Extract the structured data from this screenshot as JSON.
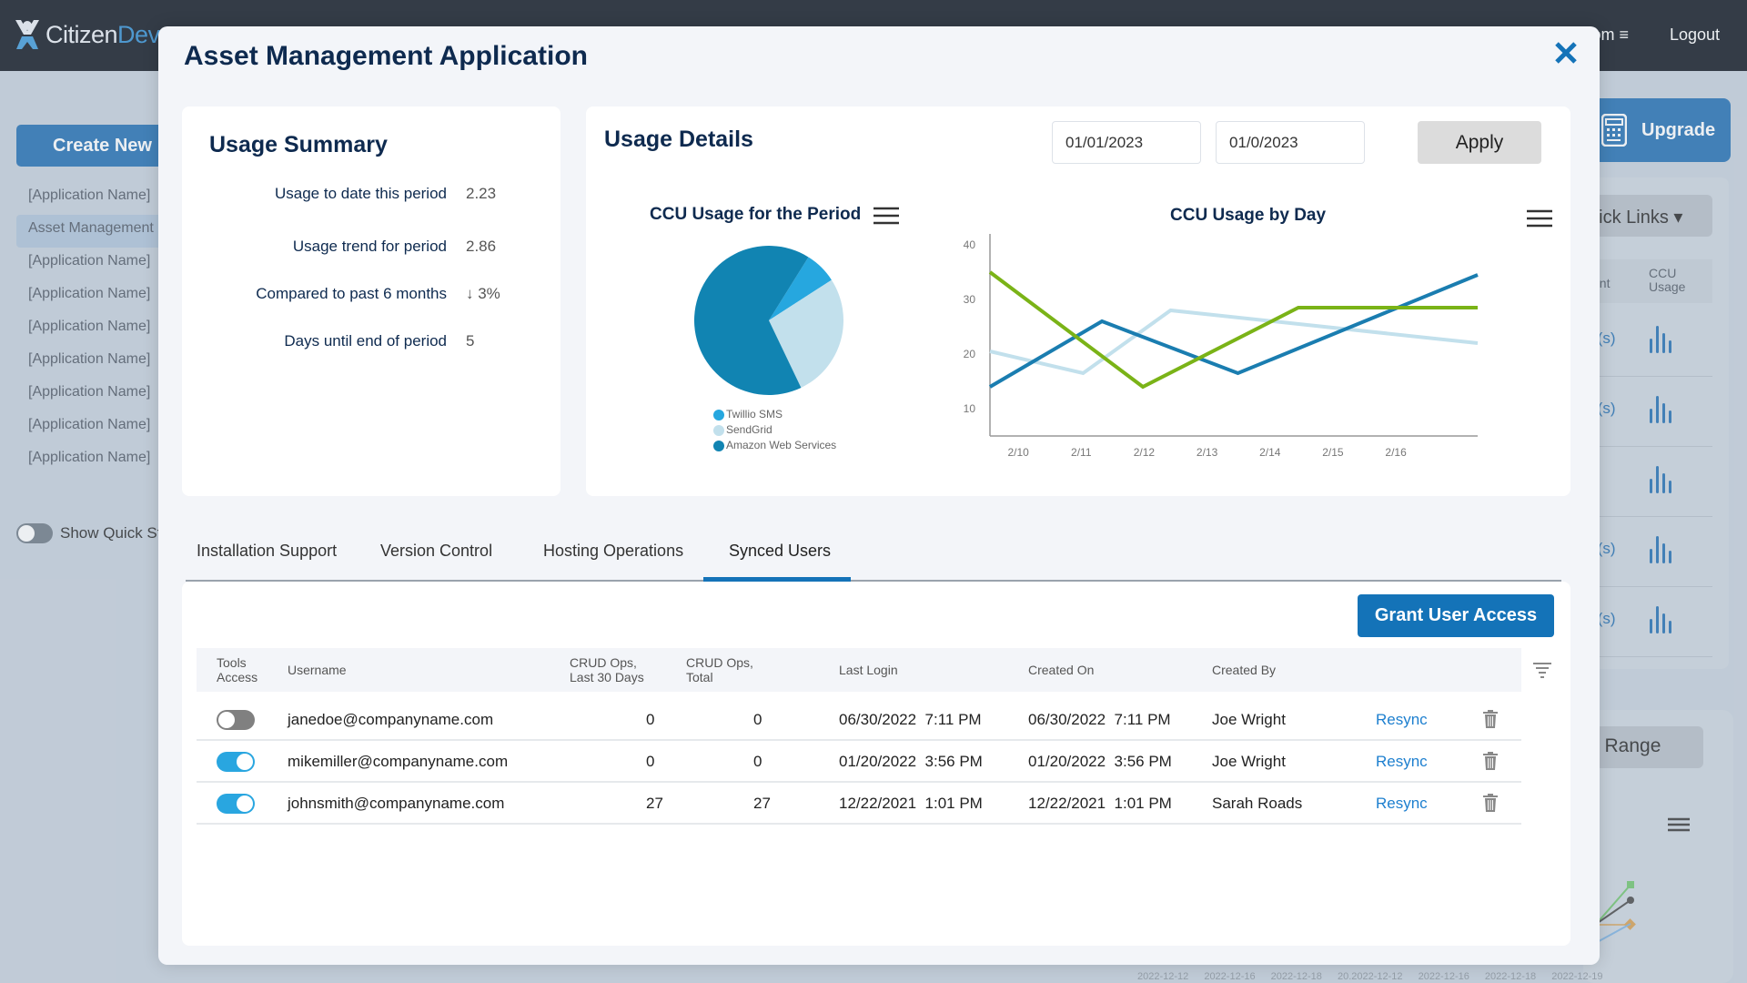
{
  "header": {
    "logo_primary": "Citizen",
    "logo_accent": "Dev",
    "menu_fragment": "om",
    "logout_label": "Logout"
  },
  "background": {
    "create_new_label": "Create New",
    "app_list": [
      "[Application Name]",
      "Asset Management",
      "[Application Name]",
      "[Application Name]",
      "[Application Name]",
      "[Application Name]",
      "[Application Name]",
      "[Application Name]",
      "[Application Name]"
    ],
    "active_app_index": 1,
    "show_quick_stats_label": "Show Quick Sta",
    "upgrade_label": "Upgrade",
    "quick_links_label": "uick Links ▾",
    "col_count_label": "unt",
    "col_ccu_label": "CCU Usage",
    "rows": [
      "r(s)",
      "r(s)",
      "",
      "r(s)",
      "r(s)"
    ],
    "date_range_label": "e Range",
    "axis_labels": "2022-12-12 2022-12-16 2022-12-18 20.2022-12-12 2022-12-16 2022-12-18 2022-12-19"
  },
  "modal": {
    "title": "Asset Management Application",
    "usage_summary": {
      "title": "Usage Summary",
      "rows": [
        {
          "label": "Usage to date this period",
          "value": "2.23"
        },
        {
          "label": "Usage trend for period",
          "value": "2.86"
        },
        {
          "label": "Compared to past 6 months",
          "value": "↓ 3%"
        },
        {
          "label": "Days until end of period",
          "value": "5"
        }
      ]
    },
    "usage_details": {
      "title": "Usage Details",
      "start_date": "01/01/2023",
      "end_date": "01/0/2023",
      "apply_label": "Apply"
    },
    "tabs": [
      {
        "label": "Installation Support",
        "active": false
      },
      {
        "label": "Version Control",
        "active": false
      },
      {
        "label": "Hosting Operations",
        "active": false
      },
      {
        "label": "Synced Users",
        "active": true
      }
    ],
    "synced_users": {
      "grant_label": "Grant User Access",
      "columns": {
        "tools_access": "Tools Access",
        "username": "Username",
        "crud_30": "CRUD Ops, Last 30 Days",
        "crud_total": "CRUD Ops, Total",
        "last_login": "Last Login",
        "created_on": "Created On",
        "created_by": "Created By"
      },
      "rows": [
        {
          "access": false,
          "username": "janedoe@companyname.com",
          "crud_30": "0",
          "crud_total": "0",
          "last_login": "06/30/2022  7:11 PM",
          "created_on": "06/30/2022  7:11 PM",
          "created_by": "Joe Wright",
          "action": "Resync"
        },
        {
          "access": true,
          "username": "mikemiller@companyname.com",
          "crud_30": "0",
          "crud_total": "0",
          "last_login": "01/20/2022  3:56 PM",
          "created_on": "01/20/2022  3:56 PM",
          "created_by": "Joe Wright",
          "action": "Resync"
        },
        {
          "access": true,
          "username": "johnsmith@companyname.com",
          "crud_30": "27",
          "crud_total": "27",
          "last_login": "12/22/2021  1:01 PM",
          "created_on": "12/22/2021  1:01 PM",
          "created_by": "Sarah Roads",
          "action": "Resync"
        }
      ]
    }
  },
  "colors": {
    "brand_blue": "#1473b8",
    "title_navy": "#0e2a4f",
    "toggle_on": "#29a6e0",
    "link": "#1d7fcf"
  },
  "chart_data": [
    {
      "type": "pie",
      "title": "CCU Usage for the Period",
      "legend_position": "bottom",
      "slices": [
        {
          "label": "Twillio SMS",
          "value": 7,
          "color": "#26a7df"
        },
        {
          "label": "SendGrid",
          "value": 27,
          "color": "#c2e0ec"
        },
        {
          "label": "Amazon Web Services",
          "value": 66,
          "color": "#1184b2"
        }
      ]
    },
    {
      "type": "line",
      "title": "CCU Usage by Day",
      "categories": [
        "2/10",
        "2/11",
        "2/12",
        "2/13",
        "2/14",
        "2/15",
        "2/16"
      ],
      "xrange": [
        -0.45,
        7.3
      ],
      "ylim": [
        5,
        42
      ],
      "yticks": [
        10,
        20,
        30,
        40
      ],
      "grid": false,
      "series": [
        {
          "name": "series-dark-blue",
          "color": "#1a7db0",
          "points": [
            [
              -0.45,
              14
            ],
            [
              1.33,
              26
            ],
            [
              3.49,
              16.5
            ],
            [
              7.3,
              34.5
            ]
          ]
        },
        {
          "name": "series-light-blue",
          "color": "#c2e0ec",
          "points": [
            [
              -0.45,
              20.5
            ],
            [
              1.03,
              16.5
            ],
            [
              2.42,
              28
            ],
            [
              7.3,
              22
            ]
          ]
        },
        {
          "name": "series-green",
          "color": "#7ab317",
          "points": [
            [
              -0.45,
              35
            ],
            [
              1.98,
              14
            ],
            [
              4.45,
              28.5
            ],
            [
              7.3,
              28.5
            ]
          ]
        }
      ]
    }
  ]
}
